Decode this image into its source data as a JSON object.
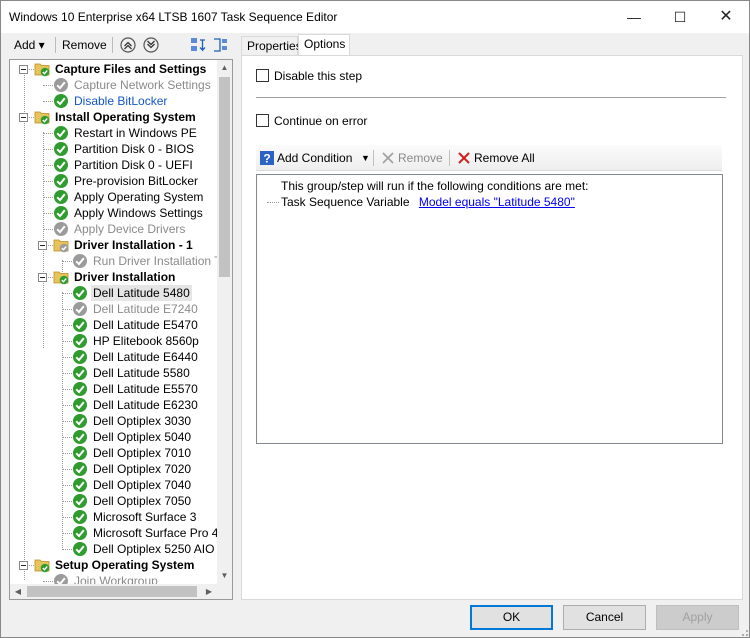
{
  "window": {
    "title": "Windows 10 Enterprise x64 LTSB 1607 Task Sequence Editor",
    "minimize": "—",
    "maximize": "☐",
    "close": "✕"
  },
  "toolbar": {
    "add_label": "Add ▾",
    "remove_label": "Remove"
  },
  "tree": [
    {
      "label": "Capture Files and Settings",
      "kind": "group",
      "status": "folder-ok",
      "depth": 0,
      "expander": true
    },
    {
      "label": "Capture Network Settings",
      "kind": "step",
      "status": "disabled",
      "depth": 1
    },
    {
      "label": "Disable BitLocker",
      "kind": "step",
      "status": "ok",
      "depth": 1,
      "style": "link"
    },
    {
      "label": "Install Operating System",
      "kind": "group",
      "status": "folder-ok",
      "depth": 0,
      "expander": true
    },
    {
      "label": "Restart in Windows PE",
      "kind": "step",
      "status": "ok",
      "depth": 1
    },
    {
      "label": "Partition Disk 0 - BIOS",
      "kind": "step",
      "status": "ok",
      "depth": 1
    },
    {
      "label": "Partition Disk 0 - UEFI",
      "kind": "step",
      "status": "ok",
      "depth": 1
    },
    {
      "label": "Pre-provision BitLocker",
      "kind": "step",
      "status": "ok",
      "depth": 1
    },
    {
      "label": "Apply Operating System",
      "kind": "step",
      "status": "ok",
      "depth": 1
    },
    {
      "label": "Apply Windows Settings",
      "kind": "step",
      "status": "ok",
      "depth": 1
    },
    {
      "label": "Apply Device Drivers",
      "kind": "step",
      "status": "disabled",
      "depth": 1
    },
    {
      "label": "Driver Installation - 1",
      "kind": "group",
      "status": "folder-disabled",
      "depth": 1,
      "expander": true
    },
    {
      "label": "Run Driver Installation TS",
      "kind": "step",
      "status": "disabled",
      "depth": 2
    },
    {
      "label": "Driver Installation",
      "kind": "group",
      "status": "folder-ok",
      "depth": 1,
      "expander": true
    },
    {
      "label": "Dell Latitude 5480",
      "kind": "step",
      "status": "ok",
      "depth": 2,
      "selected": true
    },
    {
      "label": "Dell Latitude E7240",
      "kind": "step",
      "status": "disabled",
      "depth": 2
    },
    {
      "label": "Dell Latitude E5470",
      "kind": "step",
      "status": "ok",
      "depth": 2
    },
    {
      "label": "HP Elitebook 8560p",
      "kind": "step",
      "status": "ok",
      "depth": 2
    },
    {
      "label": "Dell Latitude E6440",
      "kind": "step",
      "status": "ok",
      "depth": 2
    },
    {
      "label": "Dell Latitude 5580",
      "kind": "step",
      "status": "ok",
      "depth": 2
    },
    {
      "label": "Dell Latitude E5570",
      "kind": "step",
      "status": "ok",
      "depth": 2
    },
    {
      "label": "Dell Latitude E6230",
      "kind": "step",
      "status": "ok",
      "depth": 2
    },
    {
      "label": "Dell Optiplex 3030",
      "kind": "step",
      "status": "ok",
      "depth": 2
    },
    {
      "label": "Dell Optiplex 5040",
      "kind": "step",
      "status": "ok",
      "depth": 2
    },
    {
      "label": "Dell Optiplex 7010",
      "kind": "step",
      "status": "ok",
      "depth": 2
    },
    {
      "label": "Dell Optiplex 7020",
      "kind": "step",
      "status": "ok",
      "depth": 2
    },
    {
      "label": "Dell Optiplex 7040",
      "kind": "step",
      "status": "ok",
      "depth": 2
    },
    {
      "label": "Dell Optiplex 7050",
      "kind": "step",
      "status": "ok",
      "depth": 2
    },
    {
      "label": "Microsoft Surface 3",
      "kind": "step",
      "status": "ok",
      "depth": 2
    },
    {
      "label": "Microsoft Surface Pro 4",
      "kind": "step",
      "status": "ok",
      "depth": 2
    },
    {
      "label": "Dell Optiplex 5250 AIO",
      "kind": "step",
      "status": "ok",
      "depth": 2
    },
    {
      "label": "Setup Operating System",
      "kind": "group",
      "status": "folder-ok",
      "depth": 0,
      "expander": true
    },
    {
      "label": "Join Workgroup",
      "kind": "step",
      "status": "disabled",
      "depth": 1
    }
  ],
  "tabs": {
    "properties": "Properties",
    "options": "Options"
  },
  "options": {
    "disable_step": "Disable this step",
    "continue_on_error": "Continue on error",
    "disable_step_checked": false,
    "continue_on_error_checked": false
  },
  "conditions_toolbar": {
    "add_condition": "Add Condition",
    "remove": "Remove",
    "remove_all": "Remove All"
  },
  "conditions": {
    "header": "This group/step will run if the following conditions are met:",
    "items": [
      {
        "type": "Task Sequence Variable",
        "value": "Model equals \"Latitude 5480\""
      }
    ]
  },
  "buttons": {
    "ok": "OK",
    "cancel": "Cancel",
    "apply": "Apply"
  },
  "colors": {
    "ok_green": "#2e9c2e",
    "disabled_gray": "#9b9b9b",
    "folder_yellow": "#e8c25a",
    "link_blue": "#1155cc"
  }
}
